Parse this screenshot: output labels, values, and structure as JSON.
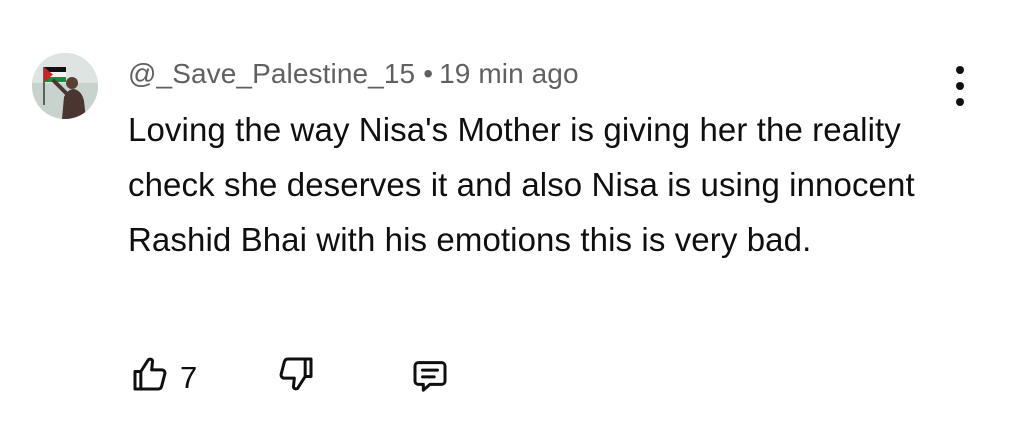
{
  "comment": {
    "author": "@_Save_Palestine_15",
    "separator": "•",
    "timestamp": "19 min ago",
    "text": "Loving the way Nisa's Mother is giving her the reality check she deserves it and also Nisa is using innocent Rashid Bhai with his emotions this is very bad.",
    "like_count": "7"
  },
  "icons": {
    "avatar": "avatar-person-with-palestine-flag",
    "more": "more-vert-icon",
    "like": "thumbs-up-icon",
    "dislike": "thumbs-down-icon",
    "reply": "reply-comment-icon"
  },
  "colors": {
    "text_primary": "#0f0f0f",
    "text_secondary": "#606060",
    "background": "#ffffff"
  }
}
